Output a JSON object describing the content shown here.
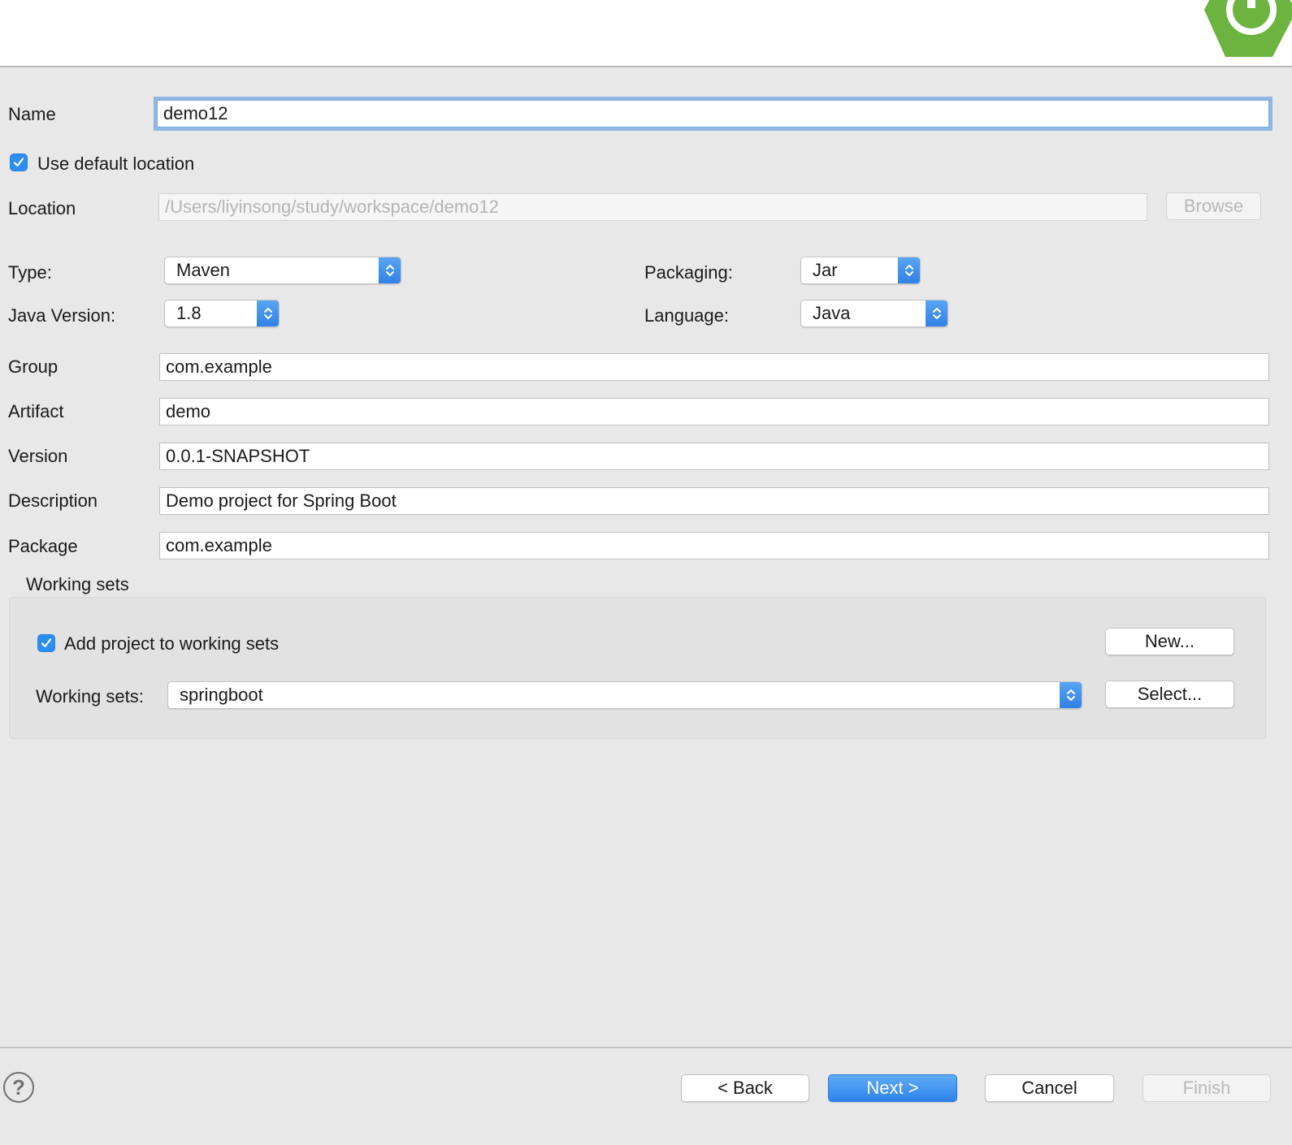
{
  "form": {
    "name_label": "Name",
    "name_value": "demo12",
    "use_default_location_label": "Use default location",
    "use_default_location_checked": true,
    "location_label": "Location",
    "location_value": "/Users/liyinsong/study/workspace/demo12",
    "browse_label": "Browse",
    "type_label": "Type:",
    "type_value": "Maven",
    "packaging_label": "Packaging:",
    "packaging_value": "Jar",
    "java_version_label": "Java Version:",
    "java_version_value": "1.8",
    "language_label": "Language:",
    "language_value": "Java",
    "group_label": "Group",
    "group_value": "com.example",
    "artifact_label": "Artifact",
    "artifact_value": "demo",
    "version_label": "Version",
    "version_value": "0.0.1-SNAPSHOT",
    "description_label": "Description",
    "description_value": "Demo project for Spring Boot",
    "package_label": "Package",
    "package_value": "com.example"
  },
  "working_sets": {
    "title": "Working sets",
    "add_label": "Add project to working sets",
    "add_checked": true,
    "new_label": "New...",
    "sets_label": "Working sets:",
    "sets_value": "springboot",
    "select_label": "Select..."
  },
  "footer": {
    "help_icon": "?",
    "back_label": "< Back",
    "next_label": "Next >",
    "cancel_label": "Cancel",
    "finish_label": "Finish"
  },
  "colors": {
    "accent": "#2f83ee",
    "spring_green": "#6db33f",
    "background": "#e8e8e8"
  }
}
